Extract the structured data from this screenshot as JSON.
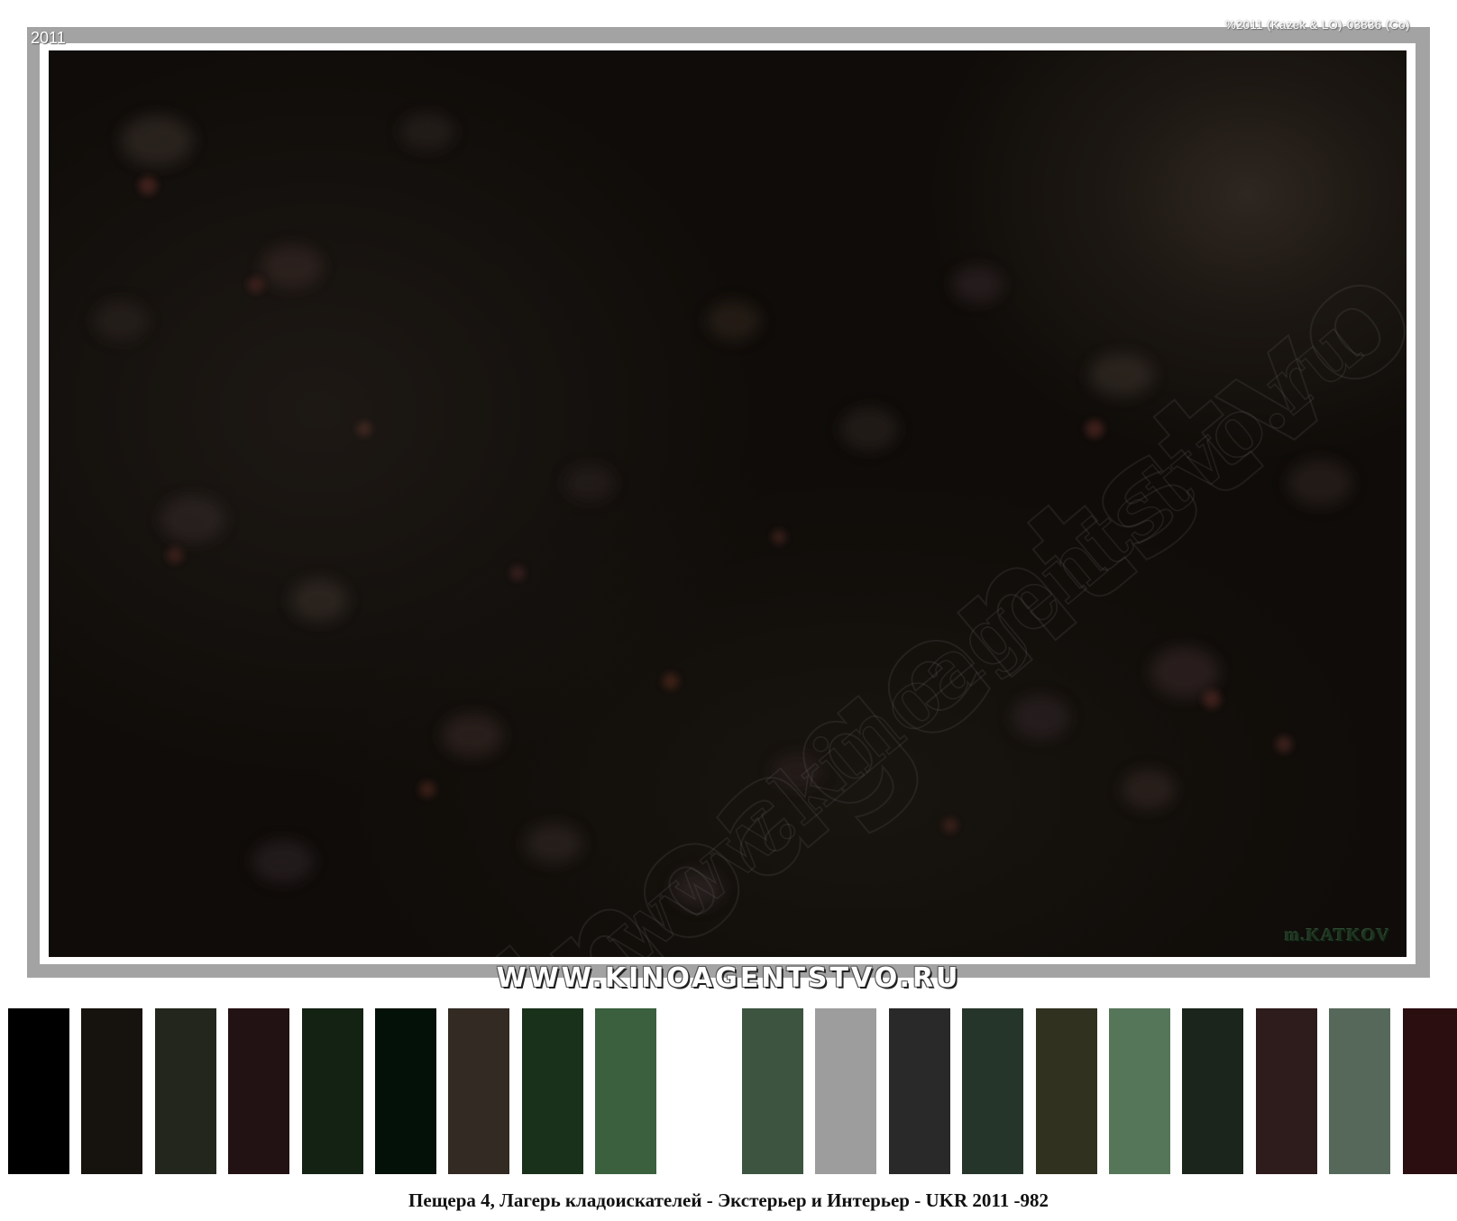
{
  "photo": {
    "year_label": "2011",
    "copyright_label": "%2011 (Kazek & LO)-03836 (Co)",
    "watermark_large": "kinoagentstvo",
    "watermark_small": "www.kinoagentstvo.ru",
    "signature": "m.KATKOV"
  },
  "banner": {
    "text": "WWW.KINOAGENTSTVO.RU"
  },
  "palette": {
    "swatches": [
      {
        "color": "#000000"
      },
      {
        "color": "#16120d"
      },
      {
        "color": "#23261d"
      },
      {
        "color": "#231214"
      },
      {
        "color": "#142213"
      },
      {
        "color": "#031108"
      },
      {
        "color": "#322a23"
      },
      {
        "color": "#19311b"
      },
      {
        "color": "#3a603e"
      },
      {
        "color": "#ffffff"
      },
      {
        "color": "#3c5440"
      },
      {
        "color": "#9d9d9d"
      },
      {
        "color": "#292929"
      },
      {
        "color": "#263529"
      },
      {
        "color": "#31311f"
      },
      {
        "color": "#56765a"
      },
      {
        "color": "#1b251b"
      },
      {
        "color": "#2e1b1c"
      },
      {
        "color": "#56685a"
      },
      {
        "color": "#2b0e10"
      }
    ]
  },
  "caption": {
    "text": "Пещера 4, Лагерь кладоискателей - Экстерьер и Интерьер - UKR 2011 -982"
  }
}
